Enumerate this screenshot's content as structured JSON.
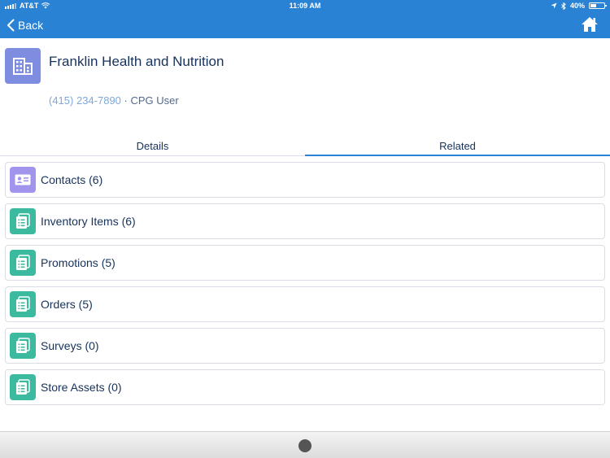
{
  "status_bar": {
    "carrier": "AT&T",
    "time": "11:09 AM",
    "battery": "40%"
  },
  "nav": {
    "back_label": "Back"
  },
  "record": {
    "title": "Franklin Health and Nutrition",
    "phone": "(415) 234-7890",
    "separator": "·",
    "role": "CPG User"
  },
  "tabs": [
    {
      "label": "Details",
      "selected": false
    },
    {
      "label": "Related",
      "selected": true
    }
  ],
  "related": [
    {
      "label": "Contacts (6)",
      "icon": "contact-card-icon",
      "color": "#a094ed"
    },
    {
      "label": "Inventory Items (6)",
      "icon": "list-icon",
      "color": "#3bba9f"
    },
    {
      "label": "Promotions (5)",
      "icon": "list-icon",
      "color": "#3bba9f"
    },
    {
      "label": "Orders (5)",
      "icon": "list-icon",
      "color": "#3bba9f"
    },
    {
      "label": "Surveys (0)",
      "icon": "list-icon",
      "color": "#3bba9f"
    },
    {
      "label": "Store Assets (0)",
      "icon": "list-icon",
      "color": "#3bba9f"
    }
  ],
  "colors": {
    "header_blue": "#2a82d4",
    "account_icon": "#7f8de1"
  }
}
